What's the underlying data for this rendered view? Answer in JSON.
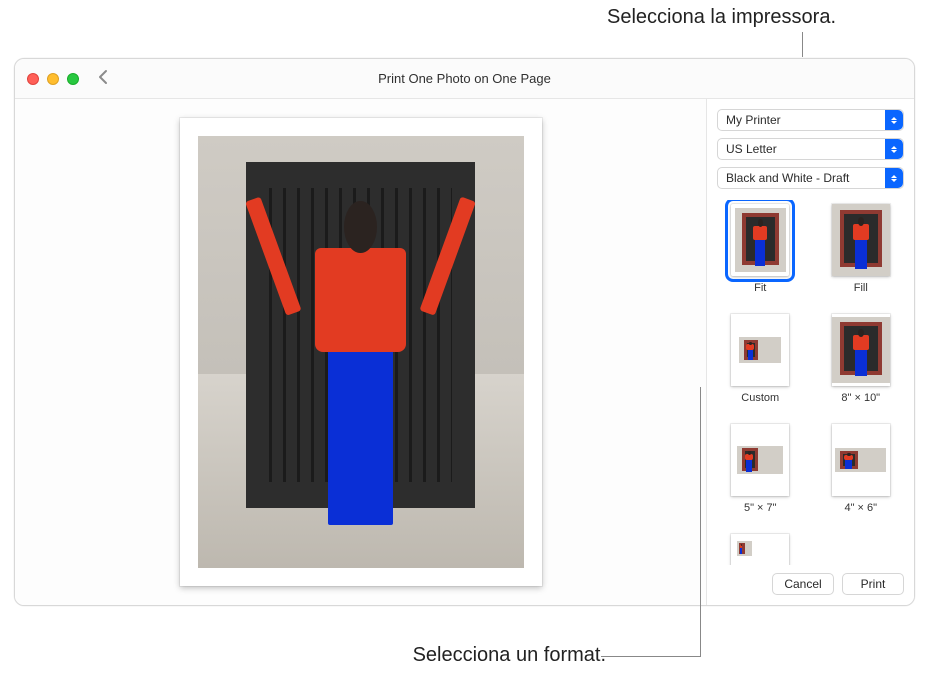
{
  "callouts": {
    "top": "Selecciona la impressora.",
    "bottom": "Selecciona un format."
  },
  "window": {
    "title": "Print One Photo on One Page"
  },
  "options": {
    "printer": "My Printer",
    "paper": "US Letter",
    "quality": "Black and White - Draft"
  },
  "layouts": [
    {
      "id": "fit",
      "label": "Fit",
      "selected": true,
      "mode": "fit"
    },
    {
      "id": "fill",
      "label": "Fill",
      "selected": false,
      "mode": "fill"
    },
    {
      "id": "custom",
      "label": "Custom",
      "selected": false,
      "mode": "custom"
    },
    {
      "id": "8x10",
      "label": "8\" × 10\"",
      "selected": false,
      "mode": "s8x10"
    },
    {
      "id": "5x7",
      "label": "5\" × 7\"",
      "selected": false,
      "mode": "s5x7"
    },
    {
      "id": "4x6",
      "label": "4\" × 6\"",
      "selected": false,
      "mode": "s4x6"
    },
    {
      "id": "contact",
      "label": "",
      "selected": false,
      "mode": "contact"
    }
  ],
  "buttons": {
    "cancel": "Cancel",
    "print": "Print"
  }
}
